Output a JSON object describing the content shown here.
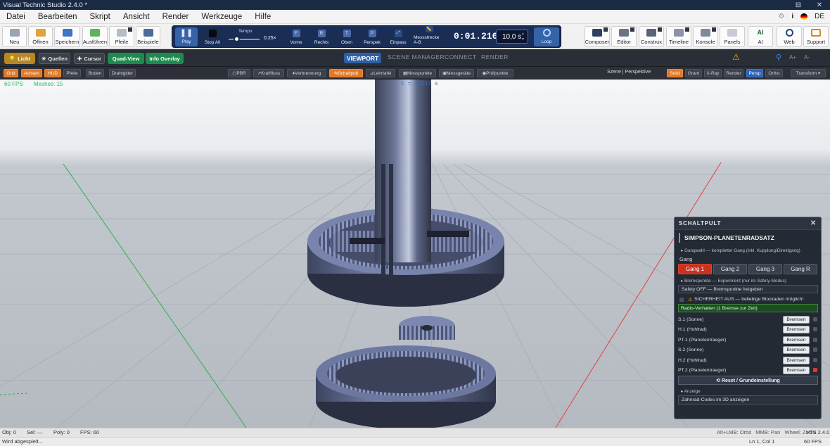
{
  "window": {
    "title": "Visual Technic Studio 2.4.0 *",
    "controls": [
      "⊟",
      "✕"
    ]
  },
  "menu": {
    "items": [
      "Datei",
      "Bearbeiten",
      "Skript",
      "Ansicht",
      "Render",
      "Werkzeuge",
      "Hilfe"
    ],
    "info_icon": "i",
    "lang": "DE"
  },
  "toolbar": {
    "left": [
      "Neu",
      "Öffnen",
      "Speichern",
      "Ausführen",
      "Pfeile",
      "Beispiele"
    ],
    "transport": {
      "play": "Play",
      "stop": "Stop All",
      "tempo_label": "Tempo",
      "tempo_value": "0.25×",
      "views": [
        "Vorne",
        "Rechts",
        "Oben",
        "Perspek",
        "Einpass",
        "Messstrecke A-B"
      ],
      "view_icons": [
        "F",
        "R",
        "T",
        "P",
        "⤢",
        "📏"
      ],
      "time": "0:01.216",
      "duration": "10,0 s",
      "loop": "Loop"
    },
    "right": [
      "Composer",
      "Editor",
      "Construx",
      "Timeline",
      "Konsole",
      "Panels",
      "AI",
      "Web",
      "Support"
    ],
    "ai_glyph": "AI"
  },
  "row3": {
    "left": [
      "Licht",
      "Quellen",
      "Cursor",
      "Quad-View",
      "Info Overlay"
    ],
    "tabs": [
      "VIEWPORT",
      "SCENE MANAGER",
      "CONNECT",
      "RENDER"
    ],
    "zoom": [
      "A+",
      "A-"
    ]
  },
  "row4": {
    "left": [
      "Grid",
      "Achsen",
      "HUD",
      "Pfeile",
      "Boden",
      "Drahtgitter"
    ],
    "middle": [
      "PBR",
      "Kraftfluss",
      "Verbrennung",
      "Schaltpult",
      "Lehrtafel",
      "Messpunkte",
      "Messgeräte",
      "Prüfpunkte"
    ],
    "scene_label": "Szene | Perspektive",
    "right": [
      "Solid",
      "Grant",
      "X-Ray",
      "Render",
      "Persp",
      "Ortho",
      "Transform ▾"
    ]
  },
  "viewport": {
    "fps": "60 FPS",
    "meshes": "Meshes: 15",
    "time_overlay": "t = 1.217 s"
  },
  "panel": {
    "header": "SCHALTPULT",
    "title": "SIMPSON-PLANETENRADSATZ",
    "gear_section": "▸ Gangwahl — kompletter Gang (inkl. Kupplung/Direktgang)",
    "gear_label": "Gang",
    "gears": [
      "Gang 1",
      "Gang 2",
      "Gang 3",
      "Gang R"
    ],
    "active_gear": 0,
    "brake_section": "▸ Bremspunkte — Experiment (nur im Safety-Modus)",
    "safety": "Safety OFF — Bremspunkte freigeben",
    "warning": "SICHERHEIT AUS — beliebige Blockaden möglich!",
    "radio": "Radio-Verhalten (1 Bremse zur Zeit)",
    "brakes": [
      {
        "name": "S.1 (Sonne)",
        "button": "Bremsen",
        "active": false
      },
      {
        "name": "H.1 (Hohlrad)",
        "button": "Bremsen",
        "active": false
      },
      {
        "name": "PT.1 (Planetentraeger)",
        "button": "Bremsen",
        "active": false
      },
      {
        "name": "S.2 (Sonne)",
        "button": "Bremsen",
        "active": false
      },
      {
        "name": "H.2 (Hohlrad)",
        "button": "Bremsen",
        "active": false
      },
      {
        "name": "PT.2 (Planetentraeger)",
        "button": "Bremsen",
        "active": true
      }
    ],
    "reset": "⟲ Reset / Grundeinstellung",
    "display_section": "▸ Anzeige",
    "codes": "Zahnrad-Codes im 3D anzeigen"
  },
  "status": {
    "obj": "Obj: 0",
    "sel": "Sel: —",
    "poly": "Poly: 0",
    "fps": "FPS: 60",
    "hints": "Alt+LMB: Orbit   MMB: Pan   Wheel: Zoom",
    "version": "VTS 2.4.0",
    "message": "Wird abgespielt...",
    "position": "Ln 1, Col 1",
    "fps2": "60 FPS"
  },
  "colors": {
    "accent": "#28b7d7",
    "active_gear": "#c8321f",
    "orange": "#e37724",
    "navy": "#1a2d55"
  }
}
